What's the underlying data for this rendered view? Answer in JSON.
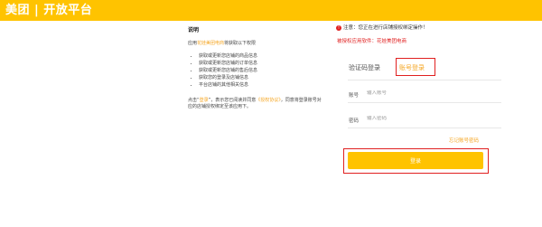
{
  "header": {
    "title": "美团 | 开放平台"
  },
  "left": {
    "title": "说明",
    "intro_prefix": "应用",
    "intro_app": "花娃美团电商",
    "intro_suffix": "将获取以下权限",
    "permissions": [
      "获取或更新您店铺的商品信息",
      "获取或更新您店铺的订单信息",
      "获取或更新您店铺的售后信息",
      "获取您的登录及店铺信息",
      "平台店铺的其他相关信息"
    ],
    "notice_prefix": "点击“",
    "notice_link1": "登录",
    "notice_mid": "”，表示您已阅读并同意",
    "notice_link2": "《授权协议》",
    "notice_suffix": "，同意将登录账号对应的店铺授权绑定至该应用下。"
  },
  "warning": {
    "dot": "!",
    "text": "注意：您正在进行店铺授权绑定操作！",
    "sub": "被授权应用软件：花娃美团电商"
  },
  "tabs": {
    "code_login": "验证码登录",
    "account_login": "账号登录"
  },
  "form": {
    "account_label": "账号",
    "account_placeholder": "输入账号",
    "password_label": "密码",
    "password_placeholder": "输入密码",
    "forgot": "忘记账号密码",
    "login_button": "登录"
  },
  "colors": {
    "brand": "#ffc300",
    "accent": "#f5a623",
    "alert": "#e02020"
  }
}
